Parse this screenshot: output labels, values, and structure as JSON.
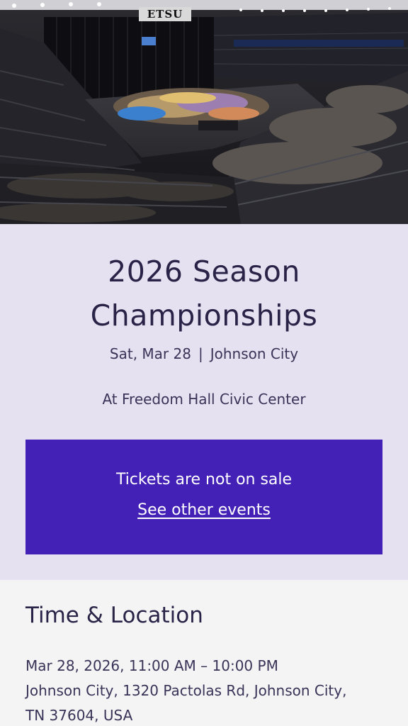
{
  "hero": {
    "image_alt": "Arena floor during championship event",
    "sign_text": "ETSU"
  },
  "event": {
    "title_line1": "2026 Season",
    "title_line2": "Championships",
    "date": "Sat, Mar 28",
    "separator": "|",
    "city": "Johnson City",
    "venue": "At Freedom Hall Civic Center"
  },
  "tickets": {
    "status": "Tickets are not on sale",
    "link_label": "See other events"
  },
  "details": {
    "heading": "Time & Location",
    "datetime": "Mar 28, 2026, 11:00 AM – 10:00 PM",
    "address_line1": "Johnson City, 1320 Pactolas Rd, Johnson City,",
    "address_line2": "TN 37604, USA"
  },
  "colors": {
    "panel_bg": "#e6e1f0",
    "text_primary": "#2a2348",
    "ticket_bg": "#4320b6",
    "page_bg": "#f4f4f4"
  }
}
